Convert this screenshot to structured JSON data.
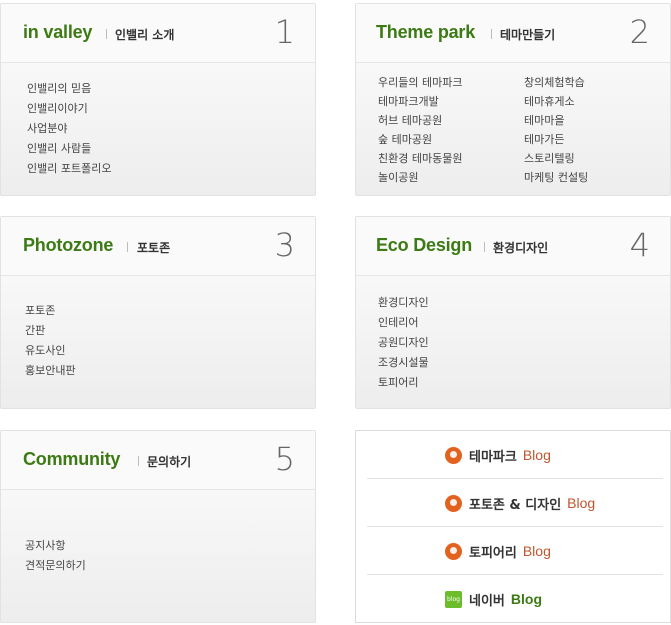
{
  "cards": [
    {
      "title": "in valley",
      "subtitle": "인밸리 소개",
      "number": "1",
      "items": [
        "인밸리의 믿음",
        "인밸리이야기",
        "사업분야",
        "인밸리 사람들",
        "인밸리 포트폴리오"
      ]
    },
    {
      "title": "Theme park",
      "subtitle": "테마만들기",
      "number": "2",
      "col1": [
        "우리들의 테마파크",
        "테마파크개발",
        "허브 테마공원",
        "숲 테마공원",
        "친환경 테마동물원",
        "놀이공원"
      ],
      "col2": [
        "창의체험학습",
        "테마휴게소",
        "테마마을",
        "테마가든",
        "스토리텔링",
        "마케팅 컨설팅"
      ]
    },
    {
      "title": "Photozone",
      "subtitle": "포토존",
      "number": "3",
      "items": [
        "포토존",
        "간판",
        "유도사인",
        "홍보안내판"
      ]
    },
    {
      "title": "Eco Design",
      "subtitle": "환경디자인",
      "number": "4",
      "items": [
        "환경디자인",
        "인테리어",
        "공원디자인",
        "조경시설물",
        "토피어리"
      ]
    },
    {
      "title": "Community",
      "subtitle": "문의하기",
      "number": "5",
      "items": [
        "공지사항",
        "견적문의하기"
      ]
    }
  ],
  "blogs": [
    {
      "name": "테마파크",
      "suffix": "Blog",
      "icon": "tistory-icon"
    },
    {
      "name": "포토존 & 디자인",
      "suffix": "Blog",
      "icon": "tistory-icon"
    },
    {
      "name": "토피어리",
      "suffix": "Blog",
      "icon": "tistory-icon"
    },
    {
      "name": "네이버",
      "suffix": "Blog",
      "icon": "naver-blog-icon",
      "icon_text": "blog"
    }
  ],
  "colors": {
    "title_green": "#3c7a14",
    "blog_orange": "#c0552f",
    "tistory": "#e3621f",
    "naver": "#6bbd2b"
  }
}
